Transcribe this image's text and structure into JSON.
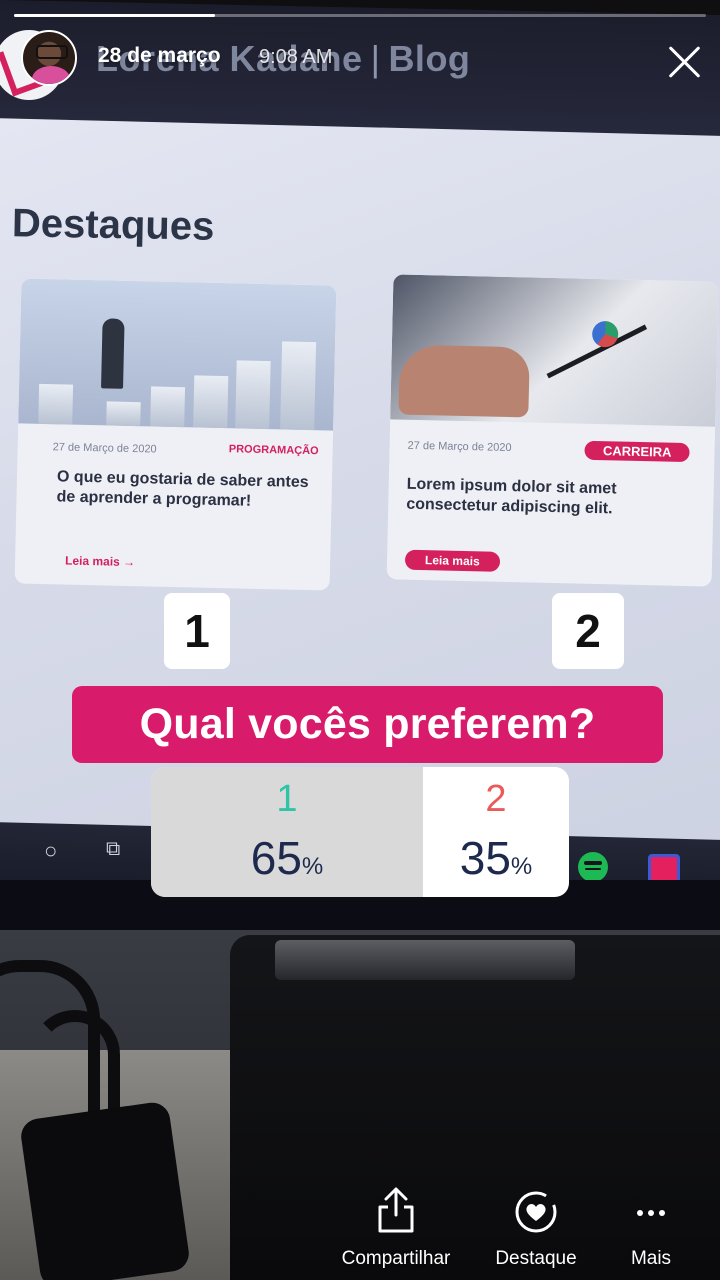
{
  "story": {
    "date": "28 de março",
    "time": "9:08 AM",
    "progress": 0.29
  },
  "blog_photo": {
    "brand_name": "Lorena Kadane",
    "brand_suffix": "Blog",
    "section_heading": "Destaques",
    "cards": [
      {
        "date": "27 de Março de 2020",
        "category": "PROGRAMAÇÃO",
        "title": "O que eu gostaria de saber antes de aprender a programar!",
        "link": "Leia mais →"
      },
      {
        "date": "27 de Março de 2020",
        "category": "CARREIRA",
        "title": "Lorem ipsum dolor sit amet consectetur adipiscing elit.",
        "link": "Leia mais"
      }
    ]
  },
  "stickers": {
    "number_left": "1",
    "number_right": "2",
    "question": "Qual vocês preferem?"
  },
  "poll": {
    "options": [
      {
        "label": "1",
        "percent": "65",
        "color": "#2ec4a5"
      },
      {
        "label": "2",
        "percent": "35",
        "color": "#ea5a5a"
      }
    ],
    "percent_sign": "%",
    "fill_fraction": 0.65
  },
  "actions": {
    "share": "Compartilhar",
    "highlight": "Destaque",
    "more": "Mais"
  },
  "colors": {
    "question_bg": "#d81b6a",
    "poll_fill": "#d9d9d9",
    "poll_percent_text": "#1d2a4d",
    "blog_accent": "#d4215e"
  }
}
